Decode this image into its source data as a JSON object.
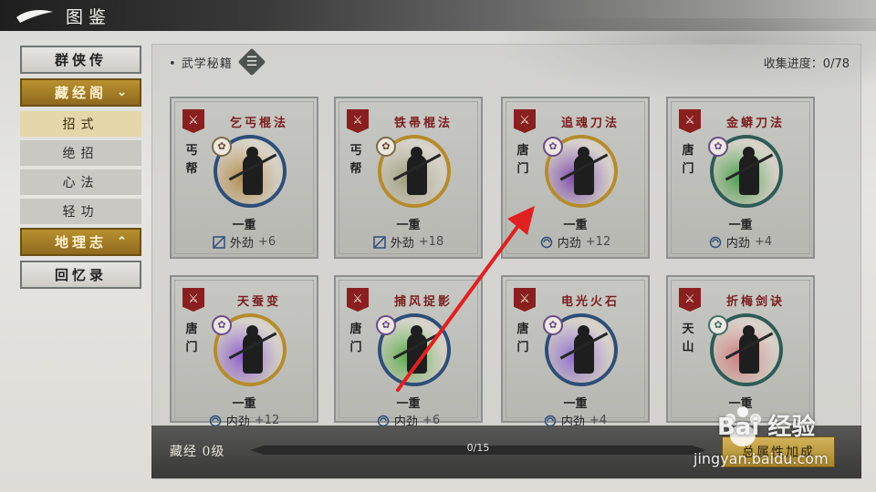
{
  "header": {
    "title": "图鉴"
  },
  "sidebar": {
    "categories": [
      {
        "label": "群侠传",
        "active": false
      },
      {
        "label": "藏经阁",
        "active": true,
        "expanded": true,
        "children": [
          {
            "label": "招式",
            "active": true
          },
          {
            "label": "绝招",
            "active": false
          },
          {
            "label": "心法",
            "active": false
          },
          {
            "label": "轻功",
            "active": false
          }
        ]
      },
      {
        "label": "地理志",
        "active": false,
        "expanded": false
      },
      {
        "label": "回忆录",
        "active": false
      }
    ]
  },
  "main": {
    "section_title": "• 武学秘籍",
    "collection_progress": "收集进度：0/78",
    "cards": [
      {
        "name": "乞丐棍法",
        "school": "丐帮",
        "level": "一重",
        "stat_type": "外劲",
        "bonus": "+6",
        "ring": "blue",
        "aura": "#b08a4a"
      },
      {
        "name": "铁帚棍法",
        "school": "丐帮",
        "level": "一重",
        "stat_type": "外劲",
        "bonus": "+18",
        "ring": "gold",
        "aura": "#9a9a7a"
      },
      {
        "name": "追魂刀法",
        "school": "唐门",
        "level": "一重",
        "stat_type": "内劲",
        "bonus": "+12",
        "ring": "gold",
        "aura": "#7a4aa8"
      },
      {
        "name": "金蟒刀法",
        "school": "唐门",
        "level": "一重",
        "stat_type": "内劲",
        "bonus": "+4",
        "ring": "green",
        "aura": "#4a9a4a"
      },
      {
        "name": "天蚕变",
        "school": "唐门",
        "level": "一重",
        "stat_type": "内劲",
        "bonus": "+12",
        "ring": "gold",
        "aura": "#8a5ac8"
      },
      {
        "name": "捕风捉影",
        "school": "唐门",
        "level": "一重",
        "stat_type": "内劲",
        "bonus": "+6",
        "ring": "blue",
        "aura": "#5aa84a"
      },
      {
        "name": "电光火石",
        "school": "唐门",
        "level": "一重",
        "stat_type": "内劲",
        "bonus": "+4",
        "ring": "blue",
        "aura": "#8a6ac8"
      },
      {
        "name": "折梅剑诀",
        "school": "天山",
        "level": "一重",
        "stat_type": "",
        "bonus": "",
        "ring": "green",
        "aura": "#c87a7a"
      }
    ]
  },
  "footer": {
    "tier_label": "藏经 0级",
    "progress_text": "0/15",
    "progress_fraction": 0,
    "bonus_button": "总属性加成"
  },
  "watermark": {
    "brand": "Bai 经验",
    "url": "jingyan.baidu.com"
  },
  "colors": {
    "accent_gold": "#b8912e",
    "tag_red": "#8a1f1f",
    "annotation_red": "#e02020"
  }
}
